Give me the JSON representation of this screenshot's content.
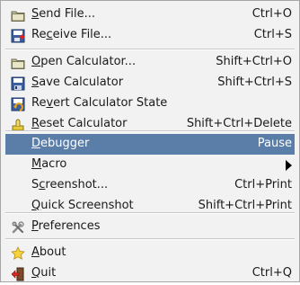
{
  "menu": {
    "items": [
      {
        "pre": "",
        "acc": "S",
        "post": "end File...",
        "shortcut": "Ctrl+O",
        "icon": "send-file-icon"
      },
      {
        "pre": "Re",
        "acc": "c",
        "post": "eive File...",
        "shortcut": "Ctrl+S",
        "icon": "receive-file-icon"
      },
      {
        "pre": "",
        "acc": "O",
        "post": "pen Calculator...",
        "shortcut": "Shift+Ctrl+O",
        "icon": "open-folder-icon"
      },
      {
        "pre": "",
        "acc": "S",
        "post": "ave Calculator",
        "shortcut": "Shift+Ctrl+S",
        "icon": "save-icon"
      },
      {
        "pre": "Re",
        "acc": "v",
        "post": "ert Calculator State",
        "shortcut": "",
        "icon": "revert-icon"
      },
      {
        "pre": "",
        "acc": "R",
        "post": "eset Calculator",
        "shortcut": "Shift+Ctrl+Delete",
        "icon": "reset-icon"
      },
      {
        "pre": "",
        "acc": "D",
        "post": "ebugger",
        "shortcut": "Pause",
        "icon": ""
      },
      {
        "pre": "",
        "acc": "M",
        "post": "acro",
        "shortcut": "",
        "icon": ""
      },
      {
        "pre": "S",
        "acc": "c",
        "post": "reenshot...",
        "shortcut": "Ctrl+Print",
        "icon": ""
      },
      {
        "pre": "",
        "acc": "Q",
        "post": "uick Screenshot",
        "shortcut": "Shift+Ctrl+Print",
        "icon": ""
      },
      {
        "pre": "",
        "acc": "P",
        "post": "references",
        "shortcut": "",
        "icon": "preferences-icon"
      },
      {
        "pre": "",
        "acc": "A",
        "post": "bout",
        "shortcut": "",
        "icon": "about-star-icon"
      },
      {
        "pre": "",
        "acc": "Q",
        "post": "uit",
        "shortcut": "Ctrl+Q",
        "icon": "quit-icon"
      }
    ],
    "selected_item": "Debugger",
    "colors": {
      "background": "#f2f2f2",
      "selection": "#5a7ea8",
      "text": "#1a1a1a",
      "border": "#a6a6a6"
    }
  }
}
